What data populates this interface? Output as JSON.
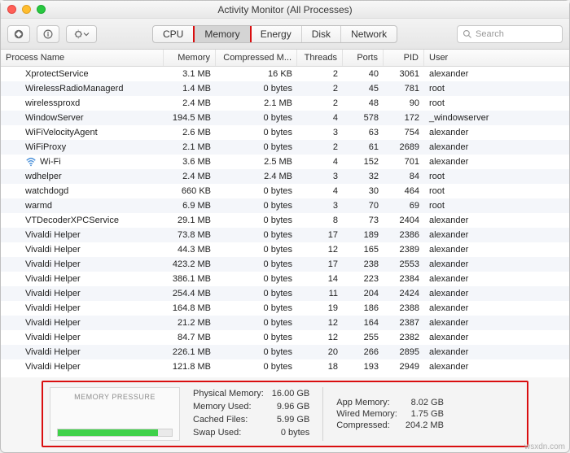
{
  "title": "Activity Monitor (All Processes)",
  "tabs": {
    "cpu": "CPU",
    "memory": "Memory",
    "energy": "Energy",
    "disk": "Disk",
    "network": "Network"
  },
  "search_placeholder": "Search",
  "columns": {
    "name": "Process Name",
    "mem": "Memory",
    "comp": "Compressed M...",
    "thr": "Threads",
    "port": "Ports",
    "pid": "PID",
    "user": "User"
  },
  "rows": [
    {
      "name": "XprotectService",
      "mem": "3.1 MB",
      "comp": "16 KB",
      "thr": "2",
      "port": "40",
      "pid": "3061",
      "user": "alexander"
    },
    {
      "name": "WirelessRadioManagerd",
      "mem": "1.4 MB",
      "comp": "0 bytes",
      "thr": "2",
      "port": "45",
      "pid": "781",
      "user": "root"
    },
    {
      "name": "wirelessproxd",
      "mem": "2.4 MB",
      "comp": "2.1 MB",
      "thr": "2",
      "port": "48",
      "pid": "90",
      "user": "root"
    },
    {
      "name": "WindowServer",
      "mem": "194.5 MB",
      "comp": "0 bytes",
      "thr": "4",
      "port": "578",
      "pid": "172",
      "user": "_windowserver"
    },
    {
      "name": "WiFiVelocityAgent",
      "mem": "2.6 MB",
      "comp": "0 bytes",
      "thr": "3",
      "port": "63",
      "pid": "754",
      "user": "alexander"
    },
    {
      "name": "WiFiProxy",
      "mem": "2.1 MB",
      "comp": "0 bytes",
      "thr": "2",
      "port": "61",
      "pid": "2689",
      "user": "alexander"
    },
    {
      "name": "Wi-Fi",
      "mem": "3.6 MB",
      "comp": "2.5 MB",
      "thr": "4",
      "port": "152",
      "pid": "701",
      "user": "alexander",
      "icon": true
    },
    {
      "name": "wdhelper",
      "mem": "2.4 MB",
      "comp": "2.4 MB",
      "thr": "3",
      "port": "32",
      "pid": "84",
      "user": "root"
    },
    {
      "name": "watchdogd",
      "mem": "660 KB",
      "comp": "0 bytes",
      "thr": "4",
      "port": "30",
      "pid": "464",
      "user": "root"
    },
    {
      "name": "warmd",
      "mem": "6.9 MB",
      "comp": "0 bytes",
      "thr": "3",
      "port": "70",
      "pid": "69",
      "user": "root"
    },
    {
      "name": "VTDecoderXPCService",
      "mem": "29.1 MB",
      "comp": "0 bytes",
      "thr": "8",
      "port": "73",
      "pid": "2404",
      "user": "alexander"
    },
    {
      "name": "Vivaldi Helper",
      "mem": "73.8 MB",
      "comp": "0 bytes",
      "thr": "17",
      "port": "189",
      "pid": "2386",
      "user": "alexander"
    },
    {
      "name": "Vivaldi Helper",
      "mem": "44.3 MB",
      "comp": "0 bytes",
      "thr": "12",
      "port": "165",
      "pid": "2389",
      "user": "alexander"
    },
    {
      "name": "Vivaldi Helper",
      "mem": "423.2 MB",
      "comp": "0 bytes",
      "thr": "17",
      "port": "238",
      "pid": "2553",
      "user": "alexander"
    },
    {
      "name": "Vivaldi Helper",
      "mem": "386.1 MB",
      "comp": "0 bytes",
      "thr": "14",
      "port": "223",
      "pid": "2384",
      "user": "alexander"
    },
    {
      "name": "Vivaldi Helper",
      "mem": "254.4 MB",
      "comp": "0 bytes",
      "thr": "11",
      "port": "204",
      "pid": "2424",
      "user": "alexander"
    },
    {
      "name": "Vivaldi Helper",
      "mem": "164.8 MB",
      "comp": "0 bytes",
      "thr": "19",
      "port": "186",
      "pid": "2388",
      "user": "alexander"
    },
    {
      "name": "Vivaldi Helper",
      "mem": "21.2 MB",
      "comp": "0 bytes",
      "thr": "12",
      "port": "164",
      "pid": "2387",
      "user": "alexander"
    },
    {
      "name": "Vivaldi Helper",
      "mem": "84.7 MB",
      "comp": "0 bytes",
      "thr": "12",
      "port": "255",
      "pid": "2382",
      "user": "alexander"
    },
    {
      "name": "Vivaldi Helper",
      "mem": "226.1 MB",
      "comp": "0 bytes",
      "thr": "20",
      "port": "266",
      "pid": "2895",
      "user": "alexander"
    },
    {
      "name": "Vivaldi Helper",
      "mem": "121.8 MB",
      "comp": "0 bytes",
      "thr": "18",
      "port": "193",
      "pid": "2949",
      "user": "alexander"
    }
  ],
  "footer": {
    "pressure_label": "MEMORY PRESSURE",
    "phys_l": "Physical Memory:",
    "phys_v": "16.00 GB",
    "used_l": "Memory Used:",
    "used_v": "9.96 GB",
    "cached_l": "Cached Files:",
    "cached_v": "5.99 GB",
    "swap_l": "Swap Used:",
    "swap_v": "0 bytes",
    "app_l": "App Memory:",
    "app_v": "8.02 GB",
    "wired_l": "Wired Memory:",
    "wired_v": "1.75 GB",
    "comp_l": "Compressed:",
    "comp_v": "204.2 MB"
  },
  "watermark": "wsxdn.com"
}
